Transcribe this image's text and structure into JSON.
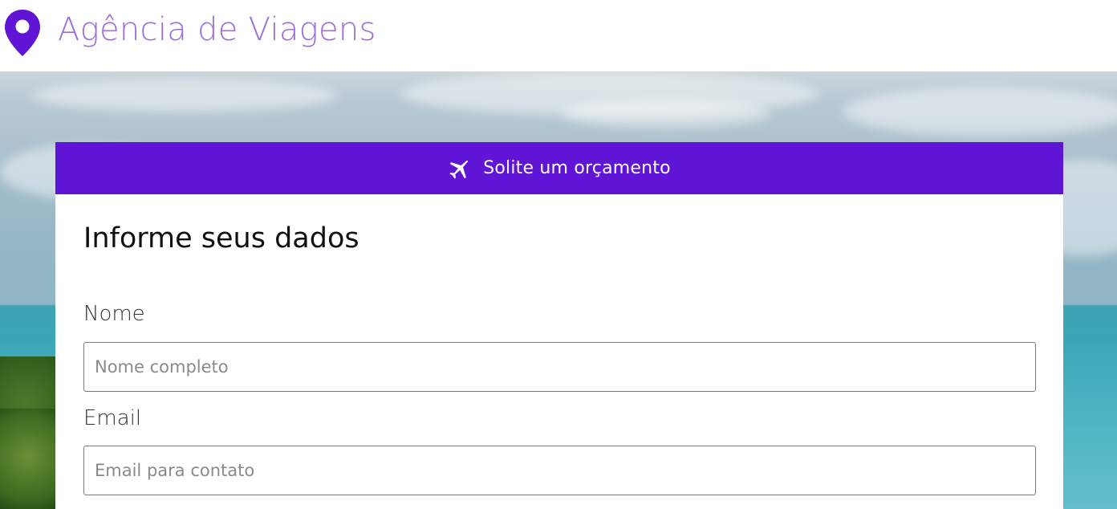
{
  "header": {
    "brand_icon": "map-pin-icon",
    "brand_title": "Agência de Viagens",
    "brand_color": "#9a6fd8",
    "icon_color": "#6015d6"
  },
  "hero": {
    "background": "beach-photo"
  },
  "quote_card": {
    "header_icon": "plane-icon",
    "header_label": "Solite um orçamento",
    "header_color": "#6015d6",
    "section_title": "Informe seus dados",
    "fields": [
      {
        "label": "Nome",
        "placeholder": "Nome completo",
        "value": ""
      },
      {
        "label": "Email",
        "placeholder": "Email para contato",
        "value": ""
      }
    ]
  }
}
